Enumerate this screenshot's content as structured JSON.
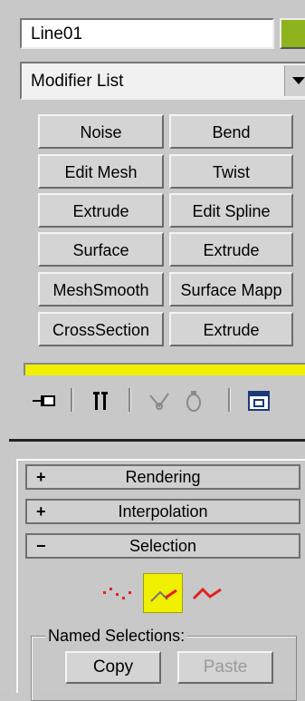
{
  "object_name": "Line01",
  "colors": {
    "object_color": "#8fb31c",
    "active_subobject": "#f0f000",
    "vertex_red": "#e02020"
  },
  "modifier_list": {
    "selected": "Modifier List"
  },
  "modifier_buttons": [
    {
      "left": "Noise",
      "right": "Bend"
    },
    {
      "left": "Edit Mesh",
      "right": "Twist"
    },
    {
      "left": "Extrude",
      "right": "Edit Spline"
    },
    {
      "left": "Surface",
      "right": "Extrude"
    },
    {
      "left": "MeshSmooth",
      "right": "Surface Mapp"
    },
    {
      "left": "CrossSection",
      "right": "Extrude"
    }
  ],
  "toolbar_icons": [
    "pin-stack-icon",
    "show-end-result-icon",
    "make-unique-icon",
    "remove-modifier-icon",
    "configure-modifier-sets-icon"
  ],
  "rollouts": [
    {
      "sign": "+",
      "title": "Rendering"
    },
    {
      "sign": "+",
      "title": "Interpolation"
    },
    {
      "sign": "−",
      "title": "Selection"
    }
  ],
  "subobject_icons": [
    "vertex-icon",
    "segment-icon",
    "spline-icon"
  ],
  "named_selections": {
    "title": "Named Selections:",
    "copy": "Copy",
    "paste": "Paste"
  }
}
